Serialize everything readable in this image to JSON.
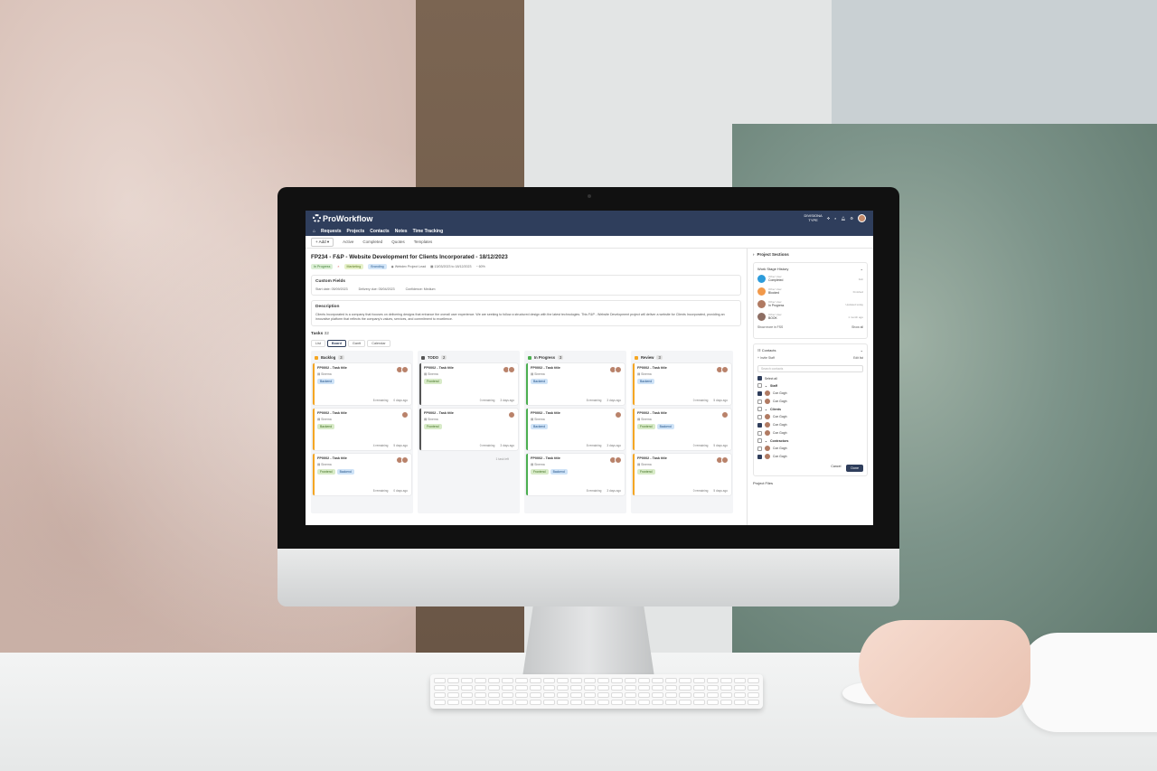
{
  "app": {
    "name": "ProWorkflow",
    "org_line1": "DIVISIONA",
    "org_line2": "TYPE"
  },
  "nav": {
    "items": [
      "Requests",
      "Projects",
      "Contacts",
      "Notes",
      "Time Tracking"
    ]
  },
  "subnav": {
    "add_label": "+ Add ▾",
    "items": [
      "Active",
      "Completed",
      "Quotes",
      "Templates"
    ]
  },
  "project": {
    "title": "FP234 - F&P - Website Development for Clients Incorporated - 18/12/2023",
    "status": "In Progress",
    "tag1": "Marketing",
    "tag2": "Branding",
    "manager": "Webdev Project Lead",
    "dates": "13/03/2023 to 18/12/2023",
    "percent": "60%"
  },
  "custom_fields": {
    "heading": "Custom Fields",
    "fields": [
      {
        "label": "Start date:",
        "value": "05/09/2023"
      },
      {
        "label": "Delivery due:",
        "value": "05/04/2023"
      },
      {
        "label": "Confidence:",
        "value": "Medium"
      }
    ]
  },
  "description": {
    "heading": "Description",
    "text": "Clients Incorporated is a company that focuses on delivering designs that enhance the overall user experience. We are seeking to follow a structured design with the latest technologies. This F&P - Website Development project will deliver a website for Clients Incorporated, providing an innovative platform that reflects the company's values, services, and commitment to excellence."
  },
  "tasks": {
    "heading": "Tasks",
    "count": "32",
    "views": [
      "List",
      "Board",
      "Gantt",
      "Calendar"
    ],
    "columns": [
      {
        "name": "Backlog",
        "count": "3",
        "color": "#f5a623",
        "cards": [
          {
            "title": "FP0002 - Task title",
            "assignee": "Sinema",
            "tags": [
              {
                "label": "Backend",
                "style": "blue"
              }
            ],
            "remaining": "8 remaining",
            "time": "0 days ago"
          },
          {
            "title": "FP0002 - Task title",
            "assignee": "Sinema",
            "tags": [
              {
                "label": "Backend",
                "style": "green"
              }
            ],
            "remaining": "4 remaining",
            "time": "5 days ago"
          },
          {
            "title": "FP0002 - Task title",
            "assignee": "Sinema",
            "tags": [
              {
                "label": "Frontend",
                "style": "green"
              },
              {
                "label": "Backend",
                "style": "blue"
              }
            ],
            "remaining": "8 remaining",
            "time": "0 days ago"
          }
        ]
      },
      {
        "name": "TODO",
        "count": "2",
        "color": "#555555",
        "cards": [
          {
            "title": "FP0002 - Task title",
            "assignee": "Sinema",
            "tags": [
              {
                "label": "Frontend",
                "style": "green"
              }
            ],
            "remaining": "0 remaining",
            "time": "3 days ago"
          },
          {
            "title": "FP0002 - Task title",
            "assignee": "Sinema",
            "tags": [
              {
                "label": "Frontend",
                "style": "green"
              }
            ],
            "remaining": "0 remaining",
            "time": "3 days ago"
          }
        ],
        "empty_note": "1 task left"
      },
      {
        "name": "In Progress",
        "count": "3",
        "color": "#4caf50",
        "cards": [
          {
            "title": "FP0002 - Task title",
            "assignee": "Sinema",
            "tags": [
              {
                "label": "Backend",
                "style": "blue"
              }
            ],
            "remaining": "8 remaining",
            "time": "3 days ago"
          },
          {
            "title": "FP0002 - Task title",
            "assignee": "Sinema",
            "tags": [
              {
                "label": "Backend",
                "style": "blue"
              }
            ],
            "remaining": "8 remaining",
            "time": "3 days ago"
          },
          {
            "title": "FP0002 - Task title",
            "assignee": "Sinema",
            "tags": [
              {
                "label": "Frontend",
                "style": "green"
              },
              {
                "label": "Backend",
                "style": "blue"
              }
            ],
            "remaining": "8 remaining",
            "time": "3 days ago"
          }
        ]
      },
      {
        "name": "Review",
        "count": "3",
        "color": "#f5a623",
        "cards": [
          {
            "title": "FP0002 - Task title",
            "assignee": "Sinema",
            "tags": [
              {
                "label": "Backend",
                "style": "blue"
              }
            ],
            "remaining": "0 remaining",
            "time": "5 days ago"
          },
          {
            "title": "FP0002 - Task title",
            "assignee": "Sinema",
            "tags": [
              {
                "label": "Frontend",
                "style": "green"
              },
              {
                "label": "Backend",
                "style": "blue"
              }
            ],
            "remaining": "0 remaining",
            "time": "5 days ago"
          },
          {
            "title": "FP0002 - Task title",
            "assignee": "Sinema",
            "tags": [
              {
                "label": "Frontend",
                "style": "green"
              }
            ],
            "remaining": "0 remaining",
            "time": "5 days ago"
          }
        ]
      }
    ]
  },
  "sidebar": {
    "heading": "Project Sections",
    "stage_history": {
      "heading": "Work Stage History",
      "stages": [
        {
          "who": "Other User",
          "state": "Completed",
          "date": "Feb",
          "color": "#2d9cdb"
        },
        {
          "who": "Other User",
          "state": "Blocked",
          "date": "Finished",
          "color": "#f2994a"
        },
        {
          "who": "Other User",
          "state": "In Progress",
          "date": "Updated today",
          "color": "#b07a62"
        },
        {
          "who": "Other User",
          "state": "BOOK",
          "date": "1 month ago",
          "color": "#8d6e63"
        }
      ],
      "show_more": "Show more in FSS",
      "show_all": "Show all"
    },
    "contacts": {
      "heading": "Contacts",
      "add_label": "+ Invite Staff",
      "edit_label": "Edit list",
      "search_placeholder": "Search contacts",
      "select_all": "Select all",
      "groups": [
        {
          "name": "Staff",
          "members": [
            {
              "name": "Con Gogh",
              "checked": true
            },
            {
              "name": "Con Gogh",
              "checked": false
            }
          ]
        },
        {
          "name": "Clients",
          "members": [
            {
              "name": "Con Gogh",
              "checked": false
            },
            {
              "name": "Con Gogh",
              "checked": true
            },
            {
              "name": "Con Gogh",
              "checked": false
            }
          ]
        },
        {
          "name": "Contractors",
          "members": [
            {
              "name": "Con Gogh",
              "checked": false
            },
            {
              "name": "Con Gogh",
              "checked": true
            }
          ]
        }
      ],
      "cancel_label": "Cancel",
      "done_label": "Done"
    },
    "files_label": "Project Files"
  }
}
